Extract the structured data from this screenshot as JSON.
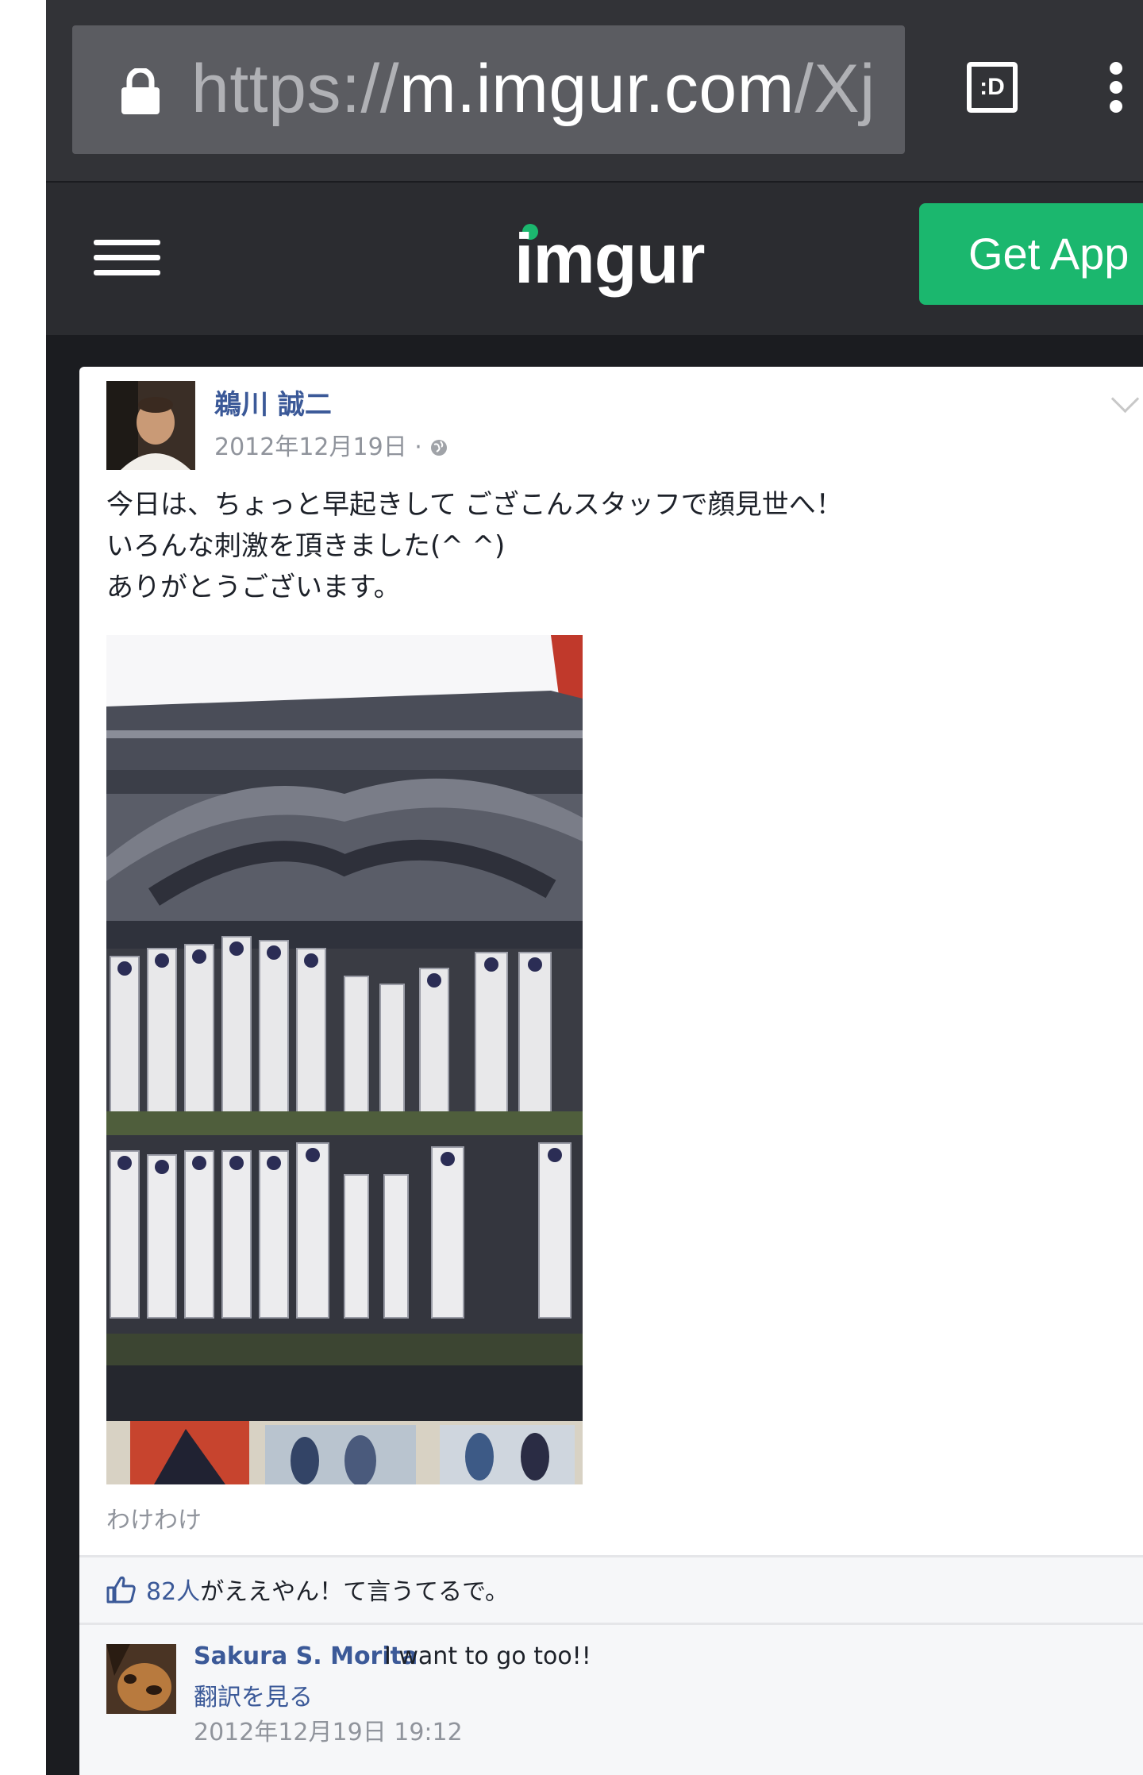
{
  "browser": {
    "url_scheme": "https://",
    "url_host": "m.imgur.com",
    "url_path": "/Xj",
    "tab_switcher_label": ":D"
  },
  "imgur_header": {
    "logo": "imgur",
    "get_app_label": "Get App"
  },
  "post": {
    "author": "鵜川 誠二",
    "date": "2012年12月19日 · ",
    "text_lines": [
      "今日は、ちょっと早起きして ござこんスタッフで顔見世へ！",
      "いろんな刺激を頂きました(^ ^)",
      "ありがとうございます。"
    ],
    "photo_caption": "わけわけ",
    "likes_count": "82人",
    "likes_suffix": "がええやん！て言うてるで。"
  },
  "comment": {
    "name": "Sakura S. Morita",
    "text": "I want to go too!!",
    "translate_label": "翻訳を見る",
    "timestamp": "2012年12月19日 19:12"
  },
  "colors": {
    "imgur_green": "#1bb76e",
    "facebook_blue": "#3b5998",
    "browser_chrome": "#323337"
  }
}
